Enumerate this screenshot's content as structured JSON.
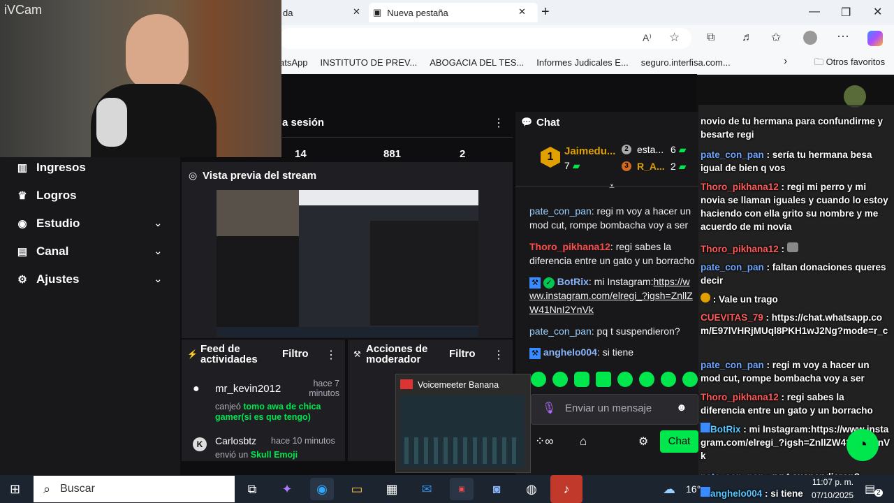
{
  "browser": {
    "tab1_label": "da",
    "tab2_label": "Nueva pestaña",
    "bookmarks": [
      "atsApp",
      "INSTITUTO DE PREV...",
      "ABOGACIA DEL TES...",
      "Informes Judicales E...",
      "seguro.interfisa.com..."
    ],
    "other_favorites": "Otros favoritos"
  },
  "webcam": {
    "label": "iVCam"
  },
  "sidebar": {
    "items": [
      {
        "label": "Ingresos",
        "icon": "chart-icon"
      },
      {
        "label": "Logros",
        "icon": "trophy-icon"
      },
      {
        "label": "Estudio",
        "icon": "camera-icon"
      },
      {
        "label": "Canal",
        "icon": "channel-icon"
      },
      {
        "label": "Ajustes",
        "icon": "gear-icon"
      }
    ]
  },
  "session": {
    "title": "a sesión",
    "stats": [
      "14",
      "881",
      "2"
    ]
  },
  "preview": {
    "title": "Vista previa del stream"
  },
  "feed": {
    "title": "Feed de actividades",
    "filter": "Filtro",
    "items": [
      {
        "user": "mr_kevin2012",
        "time": "hace 7 minutos",
        "text_prefix": "canjeó ",
        "reward": "tomo awa de chica gamer(si es que tengo)"
      },
      {
        "user": "Carlosbtz",
        "time": "hace 10 minutos",
        "text_prefix": "envió un ",
        "reward": "Skull Emoji"
      }
    ]
  },
  "mod": {
    "title": "Acciones de moderador",
    "filter": "Filtro"
  },
  "chat": {
    "title": "Chat",
    "leader1_name": "Jaimedu...",
    "leader1_points": "7",
    "leader2_name": "esta...",
    "leader2_points": "6",
    "leader3_name": "R_A...",
    "leader3_points": "2",
    "messages": [
      {
        "user": "pate_con_pan",
        "text": ": regi m voy a hacer un mod cut, rompe bombacha voy a ser"
      },
      {
        "user": "Thoro_pikhana12",
        "text": ": regi sabes la diferencia entre un gato y un borracho"
      },
      {
        "user": "BotRix",
        "text": ": mi Instagram:",
        "link": "https://www.instagram.com/elregi_?igsh=ZnllZW41NnI2YnVk"
      },
      {
        "user": "pate_con_pan",
        "text": ": pq t suspendieron?"
      },
      {
        "user": "anghelo004",
        "text": ": si tiene"
      }
    ],
    "input_placeholder": "Enviar un mensaje",
    "send_label": "Chat"
  },
  "overlay": {
    "messages": [
      {
        "user": "",
        "text": "novio de tu hermana para confundirme y besarte regi"
      },
      {
        "user": "pate_con_pan",
        "text": " : sería tu hermana besa igual de bien q vos"
      },
      {
        "user": "Thoro_pikhana12",
        "text": " : regi mi perro y mi novia se llaman iguales y cuando lo estoy haciendo con ella grito su nombre y me acuerdo de mi novia"
      },
      {
        "user": "Thoro_pikhana12",
        "text": " : "
      },
      {
        "user": "pate_con_pan",
        "text": " : faltan donaciones queres decir"
      },
      {
        "user": "",
        "text": " : Vale un trago"
      },
      {
        "user": "CUEVITAS_79",
        "text": " : https://chat.whatsapp.com/E97lVHRjMUql8PKH1wJ2Ng?mode=r_c"
      },
      {
        "user": "pate_con_pan",
        "text": " : regi m voy a hacer un mod cut, rompe bombacha voy a ser"
      },
      {
        "user": "Thoro_pikhana12",
        "text": " : regi sabes la diferencia entre un gato y un borracho"
      },
      {
        "user": "BotRix",
        "text": " : mi Instagram:https://www.instagram.com/elregi_?igsh=ZnllZW41NnI2YnVk"
      },
      {
        "user": "pate_con_pan",
        "text": " : pq t suspendieron?"
      },
      {
        "user": "anghelo004",
        "text": " : si tiene"
      }
    ]
  },
  "taskbar": {
    "search_placeholder": "Buscar",
    "temp": "16°",
    "time": "11:07 p. m.",
    "date": "07/10/2025",
    "notif_count": "2"
  },
  "voicemeeter": {
    "title": "Voicemeeter Banana"
  },
  "colors": {
    "accent_green": "#00e64d",
    "twitch_dark": "#0e0e10"
  }
}
